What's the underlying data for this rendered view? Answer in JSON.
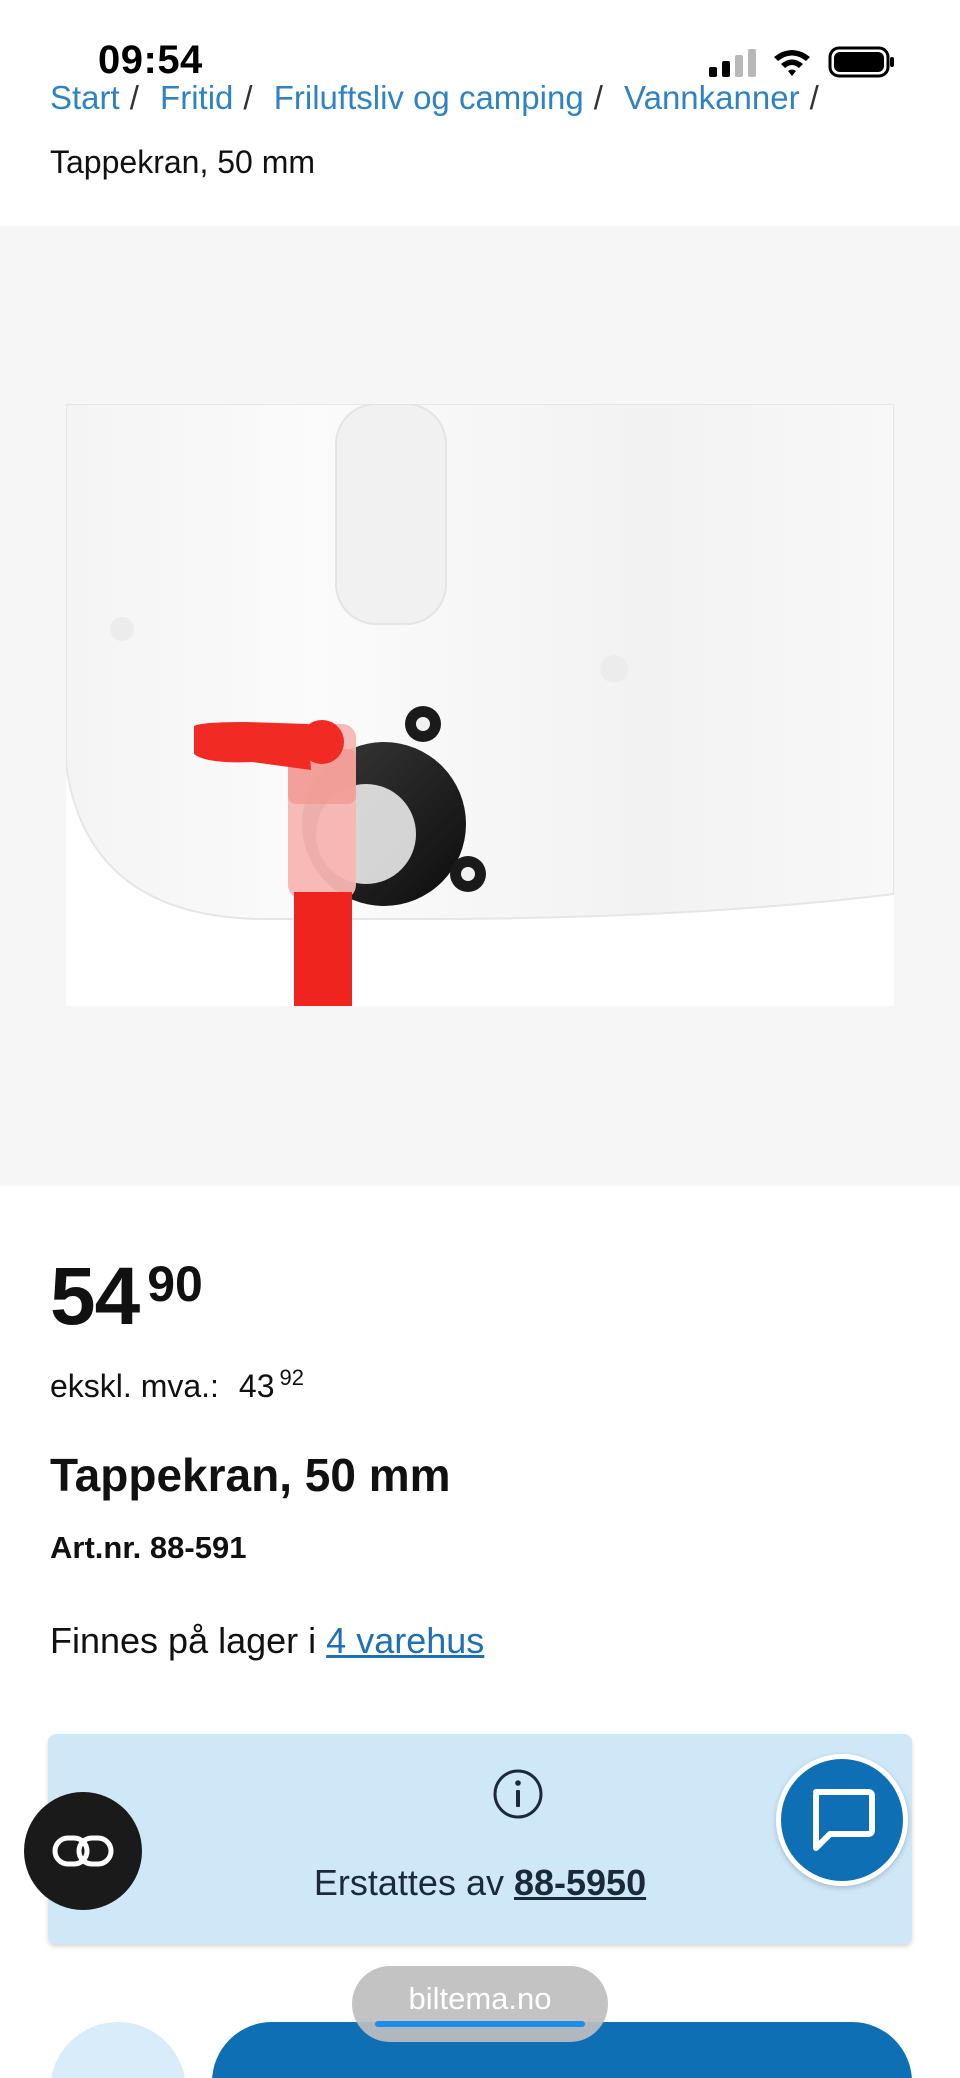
{
  "status_bar": {
    "time": "09:54"
  },
  "breadcrumb": {
    "items": [
      {
        "label": "Start"
      },
      {
        "label": "Fritid"
      },
      {
        "label": "Friluftsliv og camping"
      },
      {
        "label": "Vannkanner"
      }
    ],
    "separator": "/",
    "current": "Tappekran, 50 mm"
  },
  "product": {
    "price_main": "54",
    "price_cents": "90",
    "ex_vat_label": "ekskl. mva.:",
    "ex_vat_main": "43",
    "ex_vat_cents": "92",
    "title": "Tappekran, 50 mm",
    "article_number": "Art.nr. 88-591",
    "stock_prefix": "Finnes på lager i",
    "stock_link": "4 varehus"
  },
  "replacement": {
    "prefix": "Erstattes av",
    "link": "88-5950"
  },
  "browser": {
    "url": "biltema.no"
  },
  "colors": {
    "link": "#2f83c4",
    "brand_blue": "#0f6fb5",
    "info_bg": "#cfe8f8"
  },
  "icons": {
    "info": "info-circle-icon",
    "compare": "compare-icon",
    "chat": "chat-bubble-icon"
  }
}
